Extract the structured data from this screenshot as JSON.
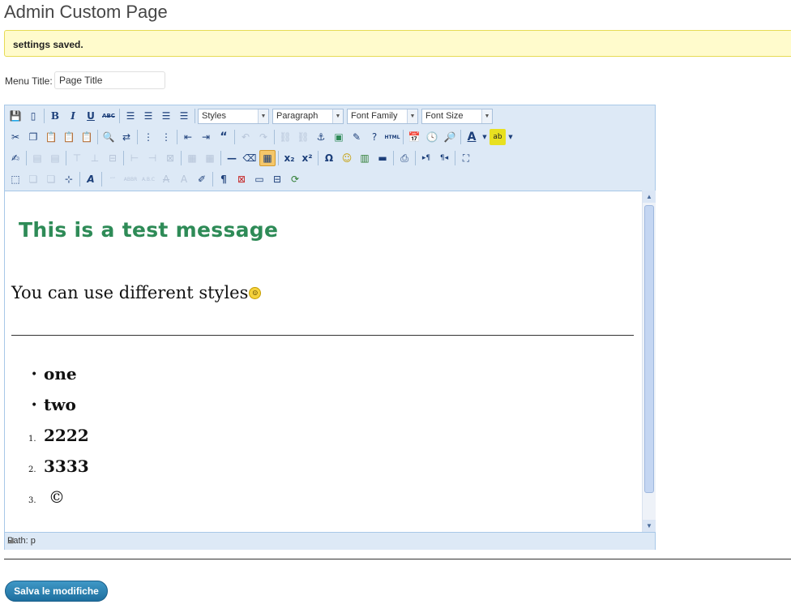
{
  "page": {
    "title": "Admin Custom Page"
  },
  "notice": {
    "text": "settings saved."
  },
  "menu_title": {
    "label": "Menu Title:",
    "value": "Page Title"
  },
  "toolbar": {
    "selects": {
      "styles": "Styles",
      "format": "Paragraph",
      "font_family": "Font Family",
      "font_size": "Font Size"
    }
  },
  "editor": {
    "heading": "This is a test message",
    "styles_text": "You can use different styles",
    "bullets": [
      "one",
      "two"
    ],
    "numbered": [
      {
        "marker": "1.",
        "text": "2222"
      },
      {
        "marker": "2.",
        "text": "3333"
      },
      {
        "marker": "3.",
        "text": "©"
      }
    ],
    "path": "Path: p"
  },
  "save_button": {
    "label": "Salva le modifiche"
  },
  "colors": {
    "heading_green": "#2e8b57",
    "notice_bg": "#fffbcc",
    "notice_border": "#e6db55",
    "button_blue": "#2a7fb0",
    "toolbar_bg": "#dde9f6"
  }
}
